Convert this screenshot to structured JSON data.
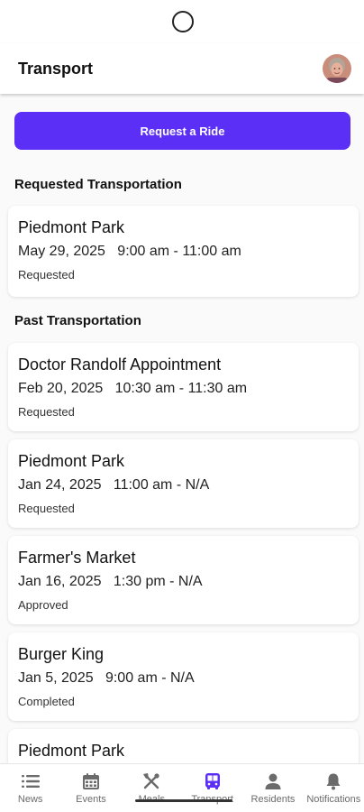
{
  "header": {
    "title": "Transport"
  },
  "actions": {
    "request_ride_label": "Request a Ride"
  },
  "sections": {
    "requested_title": "Requested Transportation",
    "past_title": "Past Transportation"
  },
  "requested": [
    {
      "title": "Piedmont Park",
      "datetime": "May 29, 2025   9:00 am - 11:00 am",
      "status": "Requested"
    }
  ],
  "past": [
    {
      "title": "Doctor Randolf Appointment",
      "datetime": "Feb 20, 2025   10:30 am - 11:30 am",
      "status": "Requested"
    },
    {
      "title": "Piedmont Park",
      "datetime": "Jan 24, 2025   11:00 am - N/A",
      "status": "Requested"
    },
    {
      "title": "Farmer's Market",
      "datetime": "Jan 16, 2025   1:30 pm - N/A",
      "status": "Approved"
    },
    {
      "title": "Burger King",
      "datetime": "Jan 5, 2025   9:00 am - N/A",
      "status": "Completed"
    },
    {
      "title": "Piedmont Park"
    }
  ],
  "nav": [
    {
      "label": "News",
      "icon": "list-icon"
    },
    {
      "label": "Events",
      "icon": "calendar-icon"
    },
    {
      "label": "Meals",
      "icon": "utensils-icon"
    },
    {
      "label": "Transport",
      "icon": "bus-icon",
      "active": true
    },
    {
      "label": "Residents",
      "icon": "person-icon"
    },
    {
      "label": "Notifications",
      "icon": "bell-icon"
    }
  ],
  "colors": {
    "accent": "#5b2ff6",
    "nav_inactive": "#6b6b6b"
  }
}
